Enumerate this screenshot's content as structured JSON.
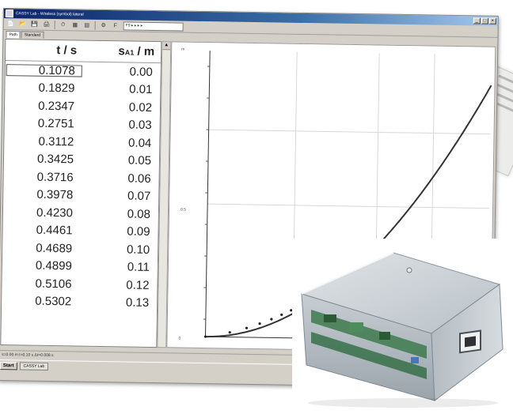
{
  "window": {
    "title": "CASSY Lab - Wireless (symbol) lateral",
    "controls": [
      "_",
      "□",
      "×"
    ]
  },
  "toolbar": {
    "buttons": [
      "📄",
      "📂",
      "💾",
      "🖨",
      "⏱",
      "▦",
      "▤",
      "⚙",
      "F"
    ],
    "combo_value": "F9 ▸ ▸ ▸ ▸"
  },
  "tabs": [
    "Path",
    "Standard"
  ],
  "table": {
    "headers": {
      "t": "t / s",
      "s_main": "s",
      "s_sub": "A1",
      "s_unit": " / m"
    },
    "rows": [
      [
        "0.1078",
        "0.00"
      ],
      [
        "0.1829",
        "0.01"
      ],
      [
        "0.2347",
        "0.02"
      ],
      [
        "0.2751",
        "0.03"
      ],
      [
        "0.3112",
        "0.04"
      ],
      [
        "0.3425",
        "0.05"
      ],
      [
        "0.3716",
        "0.06"
      ],
      [
        "0.3978",
        "0.07"
      ],
      [
        "0.4230",
        "0.08"
      ],
      [
        "0.4461",
        "0.09"
      ],
      [
        "0.4689",
        "0.10"
      ],
      [
        "0.4899",
        "0.11"
      ],
      [
        "0.5106",
        "0.12"
      ],
      [
        "0.5302",
        "0.13"
      ]
    ]
  },
  "scrollbar": {
    "up": "▲",
    "down": "▼"
  },
  "plot": {
    "y_unit_label": "m",
    "y_tick_mid": "0.5",
    "y_tick_low": "0"
  },
  "chart_data": {
    "type": "line",
    "x": [
      0.1078,
      0.1829,
      0.2347,
      0.2751,
      0.3112,
      0.3425,
      0.3716,
      0.3978,
      0.423,
      0.4461,
      0.4689,
      0.4899,
      0.5106,
      0.5302
    ],
    "y": [
      0.0,
      0.01,
      0.02,
      0.03,
      0.04,
      0.05,
      0.06,
      0.07,
      0.08,
      0.09,
      0.1,
      0.11,
      0.12,
      0.13
    ],
    "grid": true
  },
  "statusbar": {
    "text": "s=0.00 m t=0.10 s  Δt=0.008 s"
  },
  "taskbar": {
    "start": "Start",
    "item": "CASSY Lab"
  },
  "colors": {
    "title_bar": "#0a246a",
    "window_face": "#d4d0c8",
    "curve": "#333333"
  }
}
